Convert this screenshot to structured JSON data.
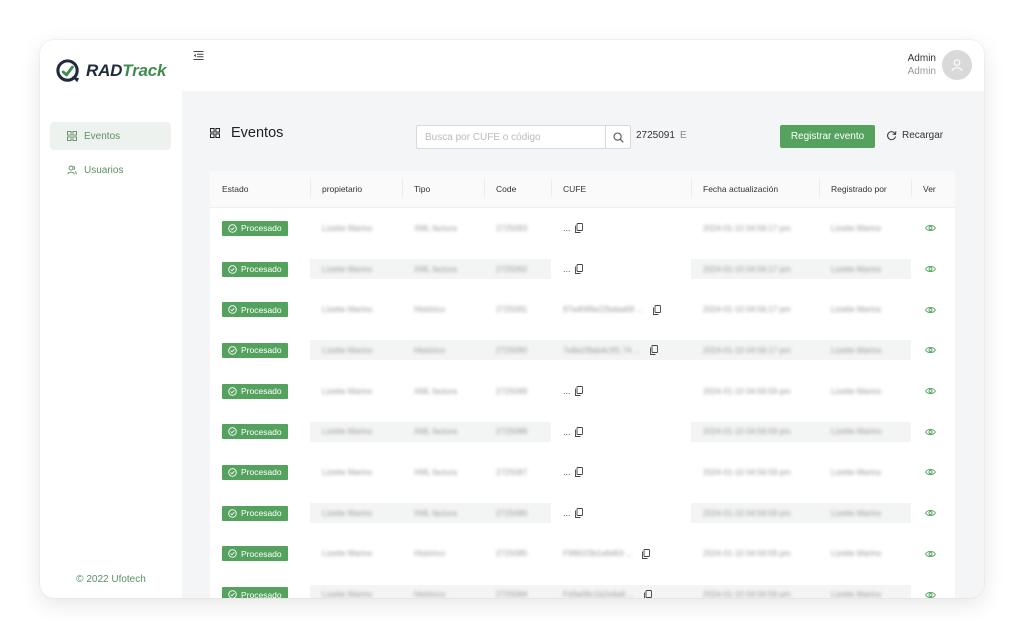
{
  "brand": {
    "name_a": "RAD",
    "name_b": "Track",
    "color": "#3f8c4e"
  },
  "sidebar": {
    "items": [
      {
        "label": "Eventos",
        "icon": "grid-icon",
        "active": true
      },
      {
        "label": "Usuarios",
        "icon": "users-icon",
        "active": false
      }
    ],
    "copyright": "© 2022 Ufotech"
  },
  "user": {
    "name": "Admin",
    "role": "Admin"
  },
  "page": {
    "title": "Eventos",
    "search_placeholder": "Busca por CUFE o código",
    "search_result": "2725091",
    "search_result_suffix": "E",
    "register_button": "Registrar evento",
    "reload_button": "Recargar"
  },
  "table": {
    "headers": [
      "Estado",
      "propietario",
      "Tipo",
      "Code",
      "CUFE",
      "Fecha actualización",
      "Registrado por",
      "Ver"
    ],
    "rows": [
      {
        "estado": "Procesado",
        "propietario": "Lizette Marino",
        "tipo": "XML factura",
        "code": "2725093",
        "cufe": "...",
        "fecha": "2024-01-10 04:56:17 pm",
        "registrado": "Lizette Marino"
      },
      {
        "estado": "Procesado",
        "propietario": "Lizette Marino",
        "tipo": "XML factura",
        "code": "2725092",
        "cufe": "...",
        "fecha": "2024-01-10 04:56:17 pm",
        "registrado": "Lizette Marino"
      },
      {
        "estado": "Procesado",
        "propietario": "Lizette Marino",
        "tipo": "Histórico",
        "code": "2725091",
        "cufe": "97a4f4f6e22bdaa69 ...",
        "fecha": "2024-01-10 04:56:17 pm",
        "registrado": "Lizette Marino"
      },
      {
        "estado": "Procesado",
        "propietario": "Lizette Marino",
        "tipo": "Histórico",
        "code": "2725090",
        "cufe": "7e8a1f9ab4c3f1.74 ...",
        "fecha": "2024-01-10 04:56:17 pm",
        "registrado": "Lizette Marino"
      },
      {
        "estado": "Procesado",
        "propietario": "Lizette Marino",
        "tipo": "XML factura",
        "code": "2725089",
        "cufe": "...",
        "fecha": "2024-01-10 04:56:59 pm",
        "registrado": "Lizette Marino"
      },
      {
        "estado": "Procesado",
        "propietario": "Lizette Marino",
        "tipo": "XML factura",
        "code": "2725088",
        "cufe": "...",
        "fecha": "2024-01-10 04:56:59 pm",
        "registrado": "Lizette Marino"
      },
      {
        "estado": "Procesado",
        "propietario": "Lizette Marino",
        "tipo": "XML factura",
        "code": "2725087",
        "cufe": "...",
        "fecha": "2024-01-10 04:56:59 pm",
        "registrado": "Lizette Marino"
      },
      {
        "estado": "Procesado",
        "propietario": "Lizette Marino",
        "tipo": "XML factura",
        "code": "2725086",
        "cufe": "...",
        "fecha": "2024-01-10 04:56:59 pm",
        "registrado": "Lizette Marino"
      },
      {
        "estado": "Procesado",
        "propietario": "Lizette Marino",
        "tipo": "Histórico",
        "code": "2725085",
        "cufe": "F9f6023b1a6d63 ...",
        "fecha": "2024-01-10 04:56:59 pm",
        "registrado": "Lizette Marino"
      },
      {
        "estado": "Procesado",
        "propietario": "Lizette Marino",
        "tipo": "Histórico",
        "code": "2725084",
        "cufe": "Fd3a09c1b2e4a6 ...",
        "fecha": "2024-01-10 04:56:59 pm",
        "registrado": "Lizette Marino"
      }
    ]
  },
  "colors": {
    "primary": "#55a25f",
    "nav_text": "#5b8f63",
    "bg": "#f4f5f6"
  }
}
